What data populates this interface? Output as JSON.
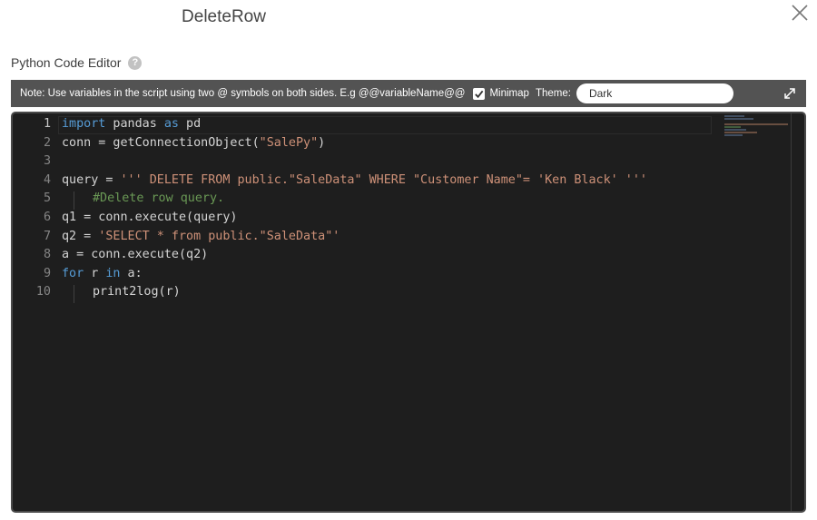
{
  "dialog": {
    "title": "DeleteRow"
  },
  "editor_label": "Python Code Editor",
  "help_icon_glyph": "?",
  "toolbar": {
    "note": "Note: Use variables in the script using two @ symbols on both sides. E.g @@variableName@@",
    "minimap_label": "Minimap",
    "minimap_checked": true,
    "theme_label": "Theme:",
    "theme_value": "Dark"
  },
  "code": {
    "line_numbers": [
      "1",
      "2",
      "3",
      "4",
      "5",
      "6",
      "7",
      "8",
      "9",
      "10"
    ],
    "line1": {
      "kw1": "import",
      "t1": " pandas ",
      "kw2": "as",
      "t2": " pd"
    },
    "line2": {
      "t1": "conn = getConnectionObject(",
      "s1": "\"SalePy\"",
      "t2": ")"
    },
    "line4": {
      "t1": "query = ",
      "s1": "''' DELETE FROM public.\"SaleData\" WHERE \"Customer Name\"= 'Ken Black' '''"
    },
    "line5": {
      "c1": "#Delete row query."
    },
    "line6": {
      "t1": "q1 = conn.execute(query)"
    },
    "line7": {
      "t1": "q2 = ",
      "s1": "'SELECT * from public.\"SaleData\"'"
    },
    "line8": {
      "t1": "a = conn.execute(q2)"
    },
    "line9": {
      "kw1": "for",
      "t1": " r ",
      "kw2": "in",
      "t2": " a:"
    },
    "line10": {
      "t1": "print2log(r)"
    }
  },
  "colors": {
    "editor_bg": "#1e1e1e",
    "toolbar_bg": "#535353",
    "keyword": "#569cd6",
    "string": "#ce9178",
    "comment": "#6a9955",
    "text": "#d4d4d4"
  },
  "icons": [
    "close-icon",
    "help-icon",
    "checkbox-check-icon",
    "expand-icon"
  ]
}
